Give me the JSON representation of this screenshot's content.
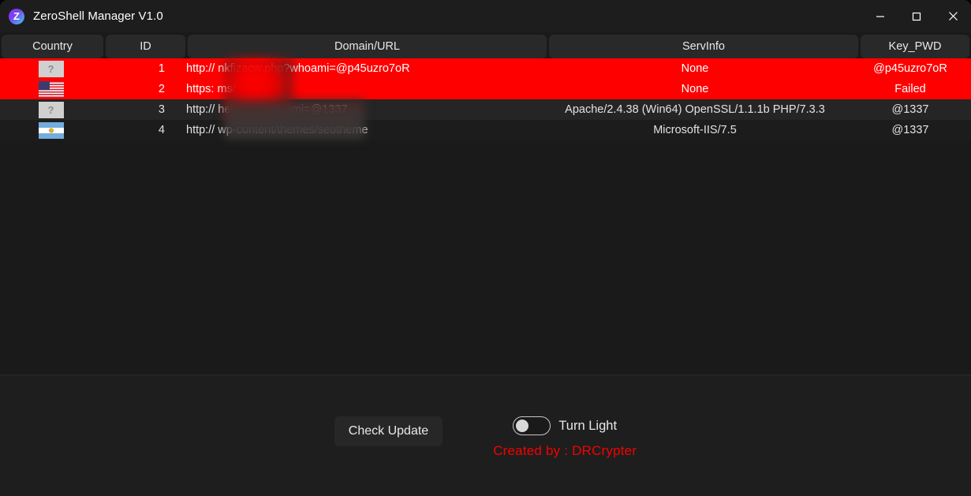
{
  "window": {
    "title": "ZeroShell Manager V1.0",
    "icon_letter": "Z",
    "controls": {
      "minimize": "minimize-icon",
      "maximize": "maximize-icon",
      "close": "close-icon"
    }
  },
  "table": {
    "columns": [
      "Country",
      "ID",
      "Domain/URL",
      "ServInfo",
      "Key_PWD"
    ],
    "rows": [
      {
        "flag": "unknown",
        "flag_text": "?",
        "id": "1",
        "url": "http://                    nkfizacw.php?whoami=@p45uzro7oR",
        "servinfo": "None",
        "key_pwd": "@p45uzro7oR",
        "highlight": true
      },
      {
        "flag": "us",
        "flag_text": "",
        "id": "2",
        "url": "https:                    ms/",
        "servinfo": "None",
        "key_pwd": "Failed",
        "highlight": true
      },
      {
        "flag": "unknown",
        "flag_text": "?",
        "id": "3",
        "url": "http://                   hell.php?whoami=@1337",
        "servinfo": "Apache/2.4.38 (Win64) OpenSSL/1.1.1b PHP/7.3.3",
        "key_pwd": "@1337",
        "highlight": false
      },
      {
        "flag": "ar",
        "flag_text": "",
        "id": "4",
        "url": "http://                              wp-content/themes/seotheme",
        "servinfo": "Microsoft-IIS/7.5",
        "key_pwd": "@1337",
        "highlight": false
      }
    ]
  },
  "footer": {
    "check_update_label": "Check Update",
    "toggle_label": "Turn Light",
    "toggle_state": "off",
    "credit": "Created by : DRCrypter",
    "credit_color": "#f50000"
  }
}
